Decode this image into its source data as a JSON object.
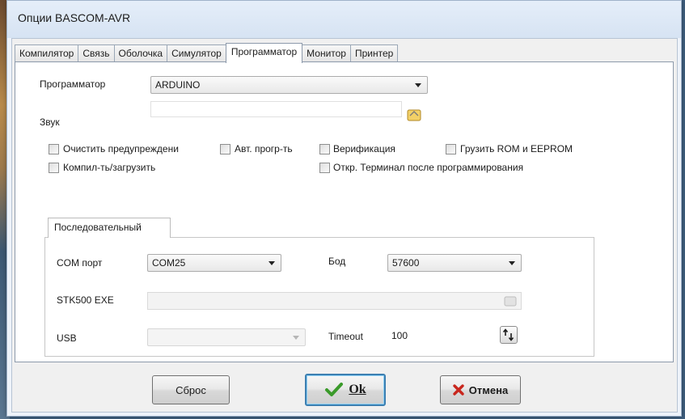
{
  "window": {
    "title": "Опции BASCOM-AVR"
  },
  "tabs": [
    {
      "label": "Компилятор",
      "active": false
    },
    {
      "label": "Связь",
      "active": false
    },
    {
      "label": "Оболочка",
      "active": false
    },
    {
      "label": "Симулятор",
      "active": false
    },
    {
      "label": "Программатор",
      "active": true
    },
    {
      "label": "Монитор",
      "active": false
    },
    {
      "label": "Принтер",
      "active": false
    }
  ],
  "programmer": {
    "label": "Программатор",
    "value": "ARDUINO",
    "sound_label": "Звук",
    "sound_value": ""
  },
  "options": {
    "clear_warnings": {
      "label": "Очистить предупреждени",
      "checked": false
    },
    "auto_program": {
      "label": "Авт. прогр-ть",
      "checked": false
    },
    "verify": {
      "label": "Верификация",
      "checked": false
    },
    "load_rom_eeprom": {
      "label": "Грузить ROM и EEPROM",
      "checked": false
    },
    "compile_upload": {
      "label": "Компил-ть/загрузить",
      "checked": false
    },
    "open_terminal": {
      "label": "Откр. Терминал после программирования",
      "checked": false
    }
  },
  "serial": {
    "tab_label": "Последовательный",
    "com_port_label": "COM порт",
    "com_port_value": "COM25",
    "baud_label": "Бод",
    "baud_value": "57600",
    "stk500_label": "STK500 EXE",
    "stk500_value": "",
    "usb_label": "USB",
    "usb_value": "",
    "timeout_label": "Timeout",
    "timeout_value": "100"
  },
  "buttons": {
    "reset": "Сброс",
    "ok": "Ok",
    "cancel": "Отмена"
  },
  "colors": {
    "ok_check": "#3a9a2a",
    "cancel_x": "#c8261d",
    "folder_icon": "#e8c04a"
  }
}
